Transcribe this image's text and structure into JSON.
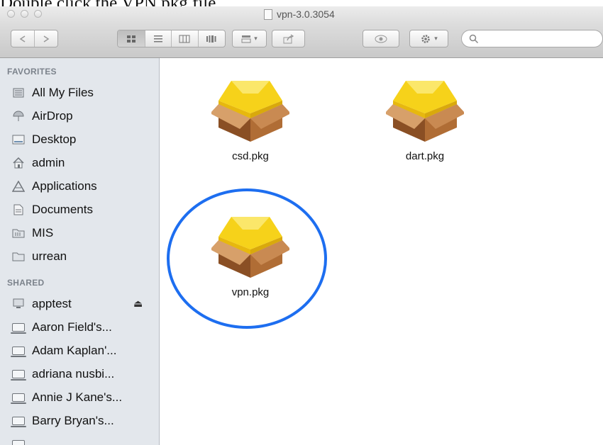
{
  "caption": "Double click the VPN.pkg file",
  "window": {
    "title": "vpn-3.0.3054"
  },
  "toolbar": {
    "back_icon": "back-arrow-icon",
    "forward_icon": "forward-arrow-icon",
    "view_modes": [
      "icon-view-icon",
      "list-view-icon",
      "column-view-icon",
      "cover-flow-icon"
    ],
    "arrange_icon": "arrange-icon",
    "share_icon": "share-icon",
    "quicklook_icon": "eye-icon",
    "action_icon": "gear-icon",
    "search_icon": "search-icon",
    "search_value": ""
  },
  "sidebar": {
    "favorites_header": "FAVORITES",
    "favorites": [
      {
        "label": "All My Files",
        "icon": "all-files-icon"
      },
      {
        "label": "AirDrop",
        "icon": "airdrop-icon"
      },
      {
        "label": "Desktop",
        "icon": "desktop-icon"
      },
      {
        "label": "admin",
        "icon": "home-icon"
      },
      {
        "label": "Applications",
        "icon": "applications-icon"
      },
      {
        "label": "Documents",
        "icon": "documents-icon"
      },
      {
        "label": "MIS",
        "icon": "folder-icon"
      },
      {
        "label": "urrean",
        "icon": "folder-icon"
      }
    ],
    "shared_header": "SHARED",
    "shared": [
      {
        "label": "apptest",
        "icon": "computer-icon",
        "eject": true
      },
      {
        "label": "Aaron Field's...",
        "icon": "laptop-icon"
      },
      {
        "label": "Adam Kaplan'...",
        "icon": "laptop-icon"
      },
      {
        "label": "adriana nusbi...",
        "icon": "laptop-icon"
      },
      {
        "label": "Annie J Kane's...",
        "icon": "laptop-icon"
      },
      {
        "label": "Barry Bryan's...",
        "icon": "laptop-icon"
      },
      {
        "label": "",
        "icon": "laptop-icon"
      }
    ]
  },
  "files": [
    {
      "name": "csd.pkg",
      "icon": "package-icon"
    },
    {
      "name": "dart.pkg",
      "icon": "package-icon"
    },
    {
      "name": "vpn.pkg",
      "icon": "package-icon"
    }
  ],
  "colors": {
    "highlight_circle": "#1d6ef0",
    "sidebar_bg": "#e3e7ec"
  }
}
